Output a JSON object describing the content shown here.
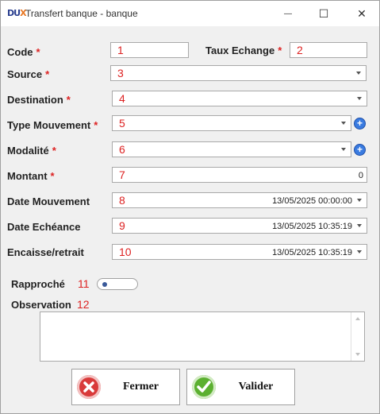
{
  "window": {
    "title": "Transfert banque  - banque",
    "logo_text": "DUX",
    "minimize_glyph": "—",
    "maximize_glyph": "☐",
    "close_glyph": "✕"
  },
  "form": {
    "required_mark": "*",
    "code": {
      "label": "Code",
      "marker": "1",
      "value": ""
    },
    "taux": {
      "label": "Taux Echange",
      "marker": "2",
      "value": ""
    },
    "source": {
      "label": "Source",
      "marker": "3",
      "value": ""
    },
    "destination": {
      "label": "Destination",
      "marker": "4",
      "value": ""
    },
    "type_mouvement": {
      "label": "Type Mouvement",
      "marker": "5",
      "value": "",
      "icon": "add-circle-icon"
    },
    "modalite": {
      "label": "Modalité",
      "marker": "6",
      "value": "",
      "icon": "add-circle-icon"
    },
    "montant": {
      "label": "Montant",
      "marker": "7",
      "value": "0"
    },
    "date_mouvement": {
      "label": "Date Mouvement",
      "marker": "8",
      "value": "13/05/2025 00:00:00"
    },
    "date_echeance": {
      "label": "Date Echéance",
      "marker": "9",
      "value": "13/05/2025 10:35:19"
    },
    "encaisse": {
      "label": "Encaisse/retrait",
      "marker": "10",
      "value": "13/05/2025 10:35:19"
    },
    "rapproche": {
      "label": "Rapproché",
      "marker": "11",
      "checked": false
    },
    "observation": {
      "label": "Observation",
      "marker": "12",
      "value": ""
    }
  },
  "buttons": {
    "fermer": {
      "label": "Fermer",
      "icon": "cancel-x-icon",
      "color": "#d93a3a"
    },
    "valider": {
      "label": "Valider",
      "icon": "checkmark-icon",
      "color": "#5bb030"
    }
  }
}
